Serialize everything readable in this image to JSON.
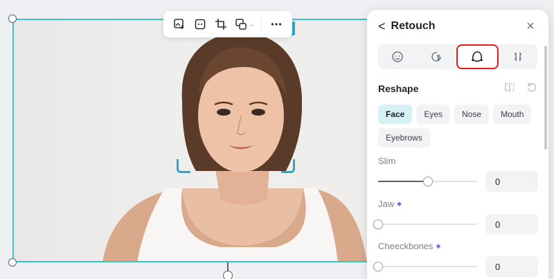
{
  "toolbar": {
    "items": [
      "add-image-icon",
      "ai-expand-icon",
      "crop-icon",
      "replace-image-icon",
      "more-icon"
    ]
  },
  "panel": {
    "back_chevron": "<",
    "title": "Retouch",
    "close_glyph": "×",
    "category_tabs": [
      "face-retouch-icon",
      "beauty-icon",
      "reshape-icon",
      "body-icon"
    ],
    "active_tab": "reshape-icon",
    "section_title": "Reshape",
    "chips": {
      "face": "Face",
      "eyes": "Eyes",
      "nose": "Nose",
      "mouth": "Mouth",
      "eyebrows": "Eyebrows"
    },
    "active_chip": "Face",
    "sliders": {
      "slim": {
        "label": "Slim",
        "value": "0",
        "level": 0.5
      },
      "jaw": {
        "label": "Jaw",
        "value": "0",
        "level": 0
      },
      "cheekbones": {
        "label": "Cheeckbones",
        "value": "0",
        "level": 0
      }
    }
  },
  "colors": {
    "selection": "#35c4c9",
    "face_bracket": "#29a9c9",
    "active_chip": "#d5f1f4",
    "highlight_box": "#e0191b",
    "premium_diamond": "#7f6df2"
  }
}
